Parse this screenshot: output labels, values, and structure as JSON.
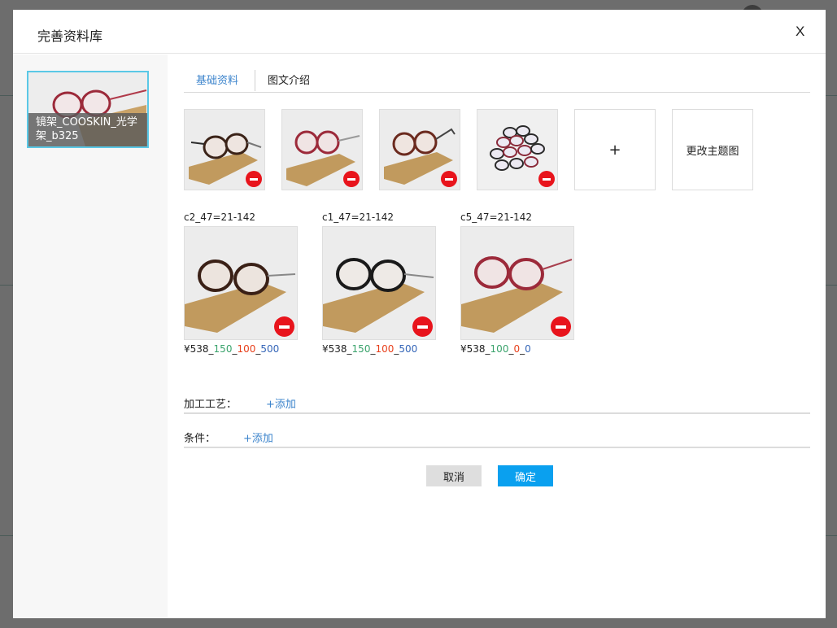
{
  "modal": {
    "title": "完善资料库",
    "close_label": "X"
  },
  "sidebar": {
    "items": [
      {
        "label": "镜架_COOSKIN_光学架_b325"
      }
    ]
  },
  "tabs": [
    {
      "label": "基础资料"
    },
    {
      "label": "图文介绍"
    }
  ],
  "gallery": {
    "add_label": "+",
    "change_main_label": "更改主题图"
  },
  "variants": [
    {
      "code": "c2_47=21-142",
      "currency": "¥",
      "price": "538",
      "v1": "150",
      "v2": "100",
      "v3": "500"
    },
    {
      "code": "c1_47=21-142",
      "currency": "¥",
      "price": "538",
      "v1": "150",
      "v2": "100",
      "v3": "500"
    },
    {
      "code": "c5_47=21-142",
      "currency": "¥",
      "price": "538",
      "v1": "100",
      "v2": "0",
      "v3": "0"
    }
  ],
  "form": {
    "process_label": "加工工艺：",
    "process_add": "+添加",
    "condition_label": "条件：",
    "condition_add": "+添加"
  },
  "buttons": {
    "cancel": "取消",
    "confirm": "确定"
  },
  "colors": {
    "accent": "#0aa0ef",
    "link": "#3c84cc",
    "remove": "#e8141c",
    "selected_border": "#5ac8e6"
  }
}
